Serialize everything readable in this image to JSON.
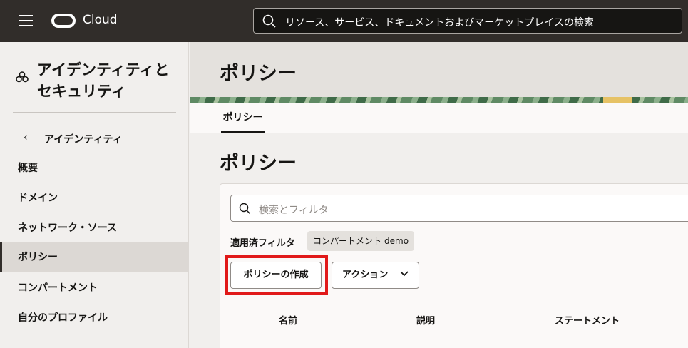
{
  "topbar": {
    "brand": "Cloud",
    "search_text": "リソース、サービス、ドキュメントおよびマーケットプレイスの検索"
  },
  "sidebar": {
    "title": "アイデンティティとセキュリティ",
    "back_label": "アイデンティティ",
    "items": [
      {
        "label": "概要",
        "active": false
      },
      {
        "label": "ドメイン",
        "active": false
      },
      {
        "label": "ネットワーク・ソース",
        "active": false
      },
      {
        "label": "ポリシー",
        "active": true
      },
      {
        "label": "コンパートメント",
        "active": false
      },
      {
        "label": "自分のプロファイル",
        "active": false
      }
    ]
  },
  "main": {
    "page_title": "ポリシー",
    "tabs": [
      {
        "label": "ポリシー"
      }
    ],
    "content_title": "ポリシー",
    "filter_placeholder": "検索とフィルタ",
    "applied_filters_label": "適用済フィルタ",
    "chip": {
      "label": "コンパートメント",
      "value": "demo"
    },
    "create_button": "ポリシーの作成",
    "action_button": "アクション",
    "columns": [
      "名前",
      "説明",
      "ステートメント"
    ]
  },
  "colors": {
    "topbar_bg": "#312d2a",
    "highlight": "#e11a1a",
    "banner_green": "#5f8a64",
    "banner_gold": "#e6c265"
  },
  "icons": [
    "menu-icon",
    "oracle-logo-icon",
    "search-icon",
    "identity-icon",
    "chevron-left-icon",
    "chevron-down-icon"
  ]
}
